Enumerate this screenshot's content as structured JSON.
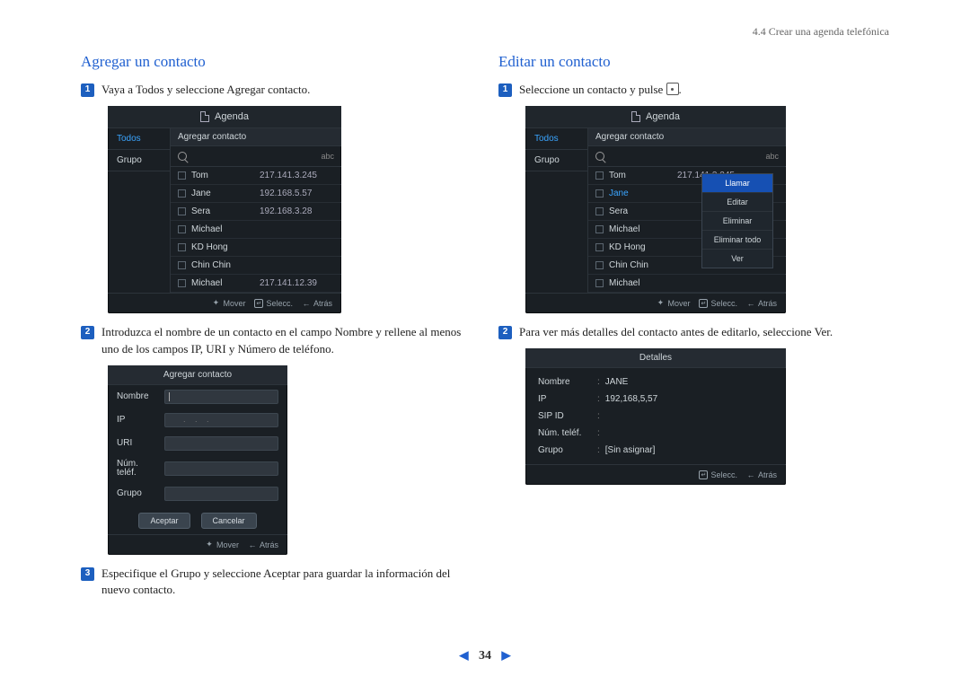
{
  "header": {
    "breadcrumb": "4.4 Crear una agenda telefónica"
  },
  "left": {
    "title": "Agregar un contacto",
    "step1": "Vaya a Todos y seleccione Agregar contacto.",
    "step2": "Introduzca el nombre de un contacto en el campo Nombre y rellene al menos uno de los campos IP, URI y Número de teléfono.",
    "step3": "Especifique el Grupo y seleccione Aceptar para guardar la información del nuevo contacto."
  },
  "right": {
    "title": "Editar un contacto",
    "step1_pre": "Seleccione un contacto y pulse ",
    "step1_post": ".",
    "step2": "Para ver más detalles del contacto antes de editarlo, seleccione Ver."
  },
  "ui": {
    "agenda_title": "Agenda",
    "sidebar": {
      "todos": "Todos",
      "grupo": "Grupo"
    },
    "add_contact": "Agregar contacto",
    "abc": "abc",
    "contacts": [
      {
        "name": "Tom",
        "ip": "217.141.3.245"
      },
      {
        "name": "Jane",
        "ip": "192.168.5.57"
      },
      {
        "name": "Sera",
        "ip": "192.168.3.28"
      },
      {
        "name": "Michael",
        "ip": ""
      },
      {
        "name": "KD Hong",
        "ip": ""
      },
      {
        "name": "Chin Chin",
        "ip": ""
      },
      {
        "name": "Michael",
        "ip": "217.141.12.39"
      }
    ],
    "footer": {
      "mover": "Mover",
      "selecc": "Selecc.",
      "atras": "Atrás"
    },
    "ctx": {
      "llamar": "Llamar",
      "editar": "Editar",
      "eliminar": "Eliminar",
      "eliminar_todo": "Eliminar todo",
      "ver": "Ver"
    },
    "form": {
      "title": "Agregar contacto",
      "nombre": "Nombre",
      "ip": "IP",
      "uri": "URI",
      "num": "Núm.\nteléf.",
      "grupo": "Grupo",
      "aceptar": "Aceptar",
      "cancelar": "Cancelar"
    },
    "details": {
      "title": "Detalles",
      "nombre_l": "Nombre",
      "nombre_v": "JANE",
      "ip_l": "IP",
      "ip_v": "192,168,5,57",
      "sip_l": "SIP ID",
      "num_l": "Núm. teléf.",
      "grupo_l": "Grupo",
      "grupo_v": "[Sin asignar]"
    }
  },
  "page": {
    "number": "34"
  }
}
